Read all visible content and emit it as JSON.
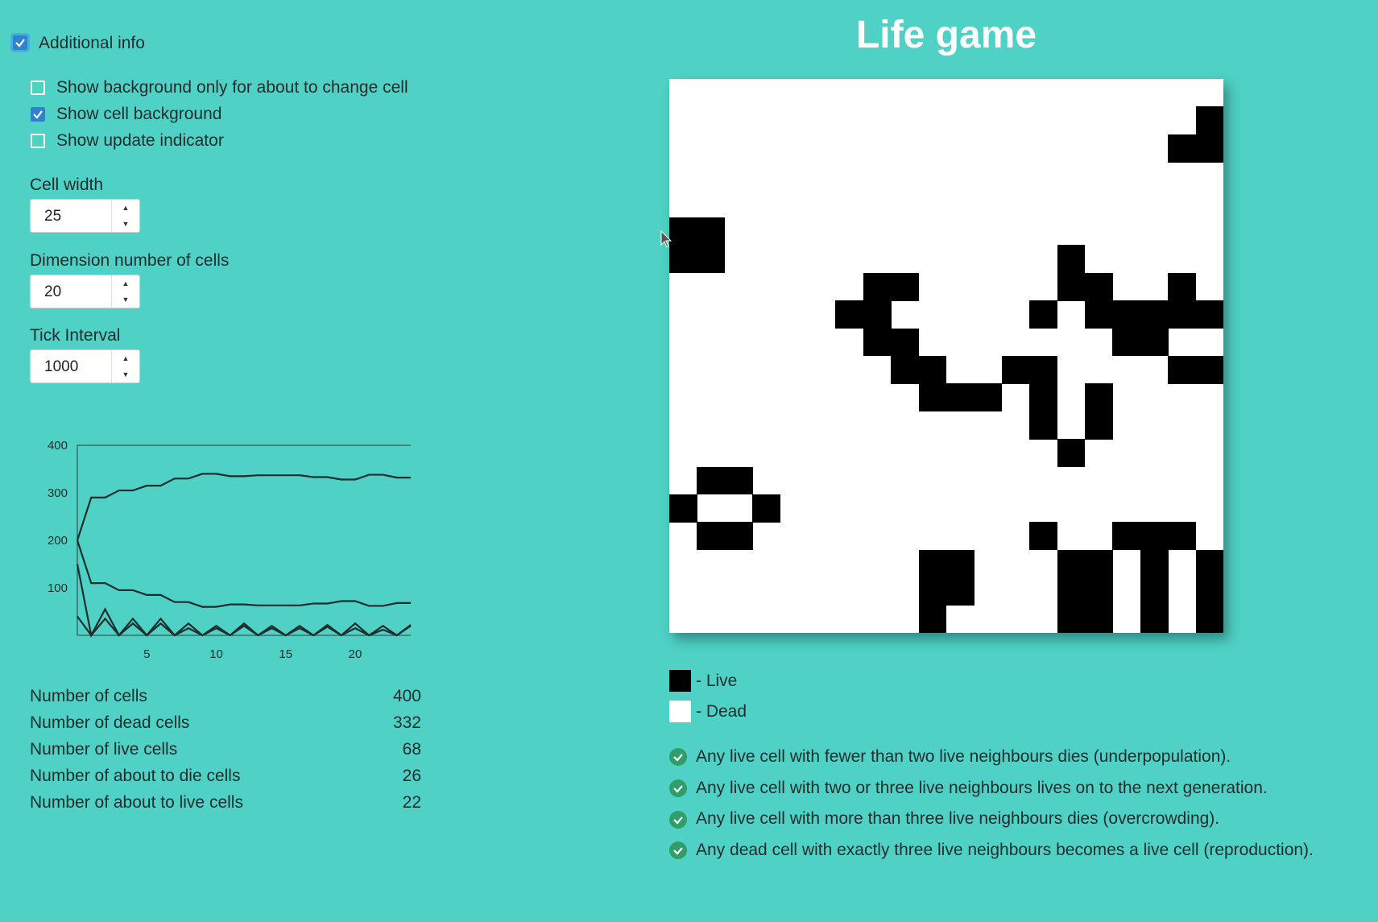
{
  "options": {
    "additional_info": {
      "label": "Additional info",
      "checked": true
    },
    "show_background_about_to_change": {
      "label": "Show background only for about to change cell",
      "checked": false
    },
    "show_cell_background": {
      "label": "Show cell background",
      "checked": true
    },
    "show_update_indicator": {
      "label": "Show update indicator",
      "checked": false
    }
  },
  "fields": {
    "cell_width": {
      "label": "Cell width",
      "value": "25"
    },
    "dimension": {
      "label": "Dimension number of cells",
      "value": "20"
    },
    "tick_interval": {
      "label": "Tick Interval",
      "value": "1000"
    }
  },
  "chart_data": {
    "type": "line",
    "x": [
      0,
      1,
      2,
      3,
      4,
      5,
      6,
      7,
      8,
      9,
      10,
      11,
      12,
      13,
      14,
      15,
      16,
      17,
      18,
      19,
      20,
      21,
      22,
      23,
      24
    ],
    "xticks": [
      "5",
      "10",
      "15",
      "20"
    ],
    "yticks": [
      "400",
      "300",
      "200",
      "100"
    ],
    "ylim": [
      0,
      400
    ],
    "xlim": [
      0,
      24
    ],
    "series": [
      {
        "values": [
          200,
          290,
          290,
          305,
          305,
          315,
          315,
          330,
          330,
          340,
          340,
          335,
          335,
          337,
          337,
          337,
          337,
          333,
          333,
          328,
          328,
          338,
          338,
          332,
          332
        ]
      },
      {
        "values": [
          200,
          110,
          110,
          95,
          95,
          85,
          85,
          70,
          70,
          60,
          60,
          65,
          65,
          63,
          63,
          63,
          63,
          67,
          67,
          72,
          72,
          62,
          62,
          68,
          68
        ]
      },
      {
        "values": [
          150,
          0,
          55,
          0,
          35,
          0,
          35,
          0,
          25,
          0,
          20,
          0,
          25,
          0,
          20,
          0,
          20,
          0,
          22,
          0,
          25,
          0,
          20,
          0,
          22
        ]
      },
      {
        "values": [
          40,
          0,
          35,
          0,
          25,
          0,
          25,
          0,
          15,
          0,
          15,
          0,
          20,
          0,
          15,
          0,
          15,
          0,
          18,
          0,
          15,
          0,
          12,
          0,
          20
        ]
      }
    ]
  },
  "stats": [
    {
      "label": "Number of cells",
      "value": "400"
    },
    {
      "label": "Number of dead cells",
      "value": "332"
    },
    {
      "label": "Number of live cells",
      "value": "68"
    },
    {
      "label": "Number of about to die cells",
      "value": "26"
    },
    {
      "label": "Number of about to live cells",
      "value": "22"
    }
  ],
  "title": "Life game",
  "board": {
    "size": 20,
    "rows": [
      "00000000000000000000",
      "000000000000000000011",
      "00000000000000000011",
      "00000000000000000000",
      "00000000000000000000",
      "11000000000000000000",
      "11000000000000100000",
      "00000001100000110010",
      "00000011000001011111",
      "00000001100000001100",
      "00000000110011000011",
      "00000000011101010000",
      "00000000000001010000",
      "00000000000000100000",
      "01100000000000000000",
      "10010000000000000000",
      "01100000000001001110",
      "00000000011000110101",
      "00000000011000110101",
      "00000000010000110101"
    ]
  },
  "legend": [
    {
      "label": "- Live",
      "color": "#000000"
    },
    {
      "label": "- Dead",
      "color": "#ffffff"
    }
  ],
  "rules": [
    "Any live cell with fewer than two live neighbours dies (underpopulation).",
    "Any live cell with two or three live neighbours lives on to the next generation.",
    "Any live cell with more than three live neighbours dies (overcrowding).",
    "Any dead cell with exactly three live neighbours becomes a live cell (reproduction)."
  ],
  "colors": {
    "background": "#4fd1c5",
    "accent": "#3182ce",
    "check_green": "#2f9e6a"
  }
}
